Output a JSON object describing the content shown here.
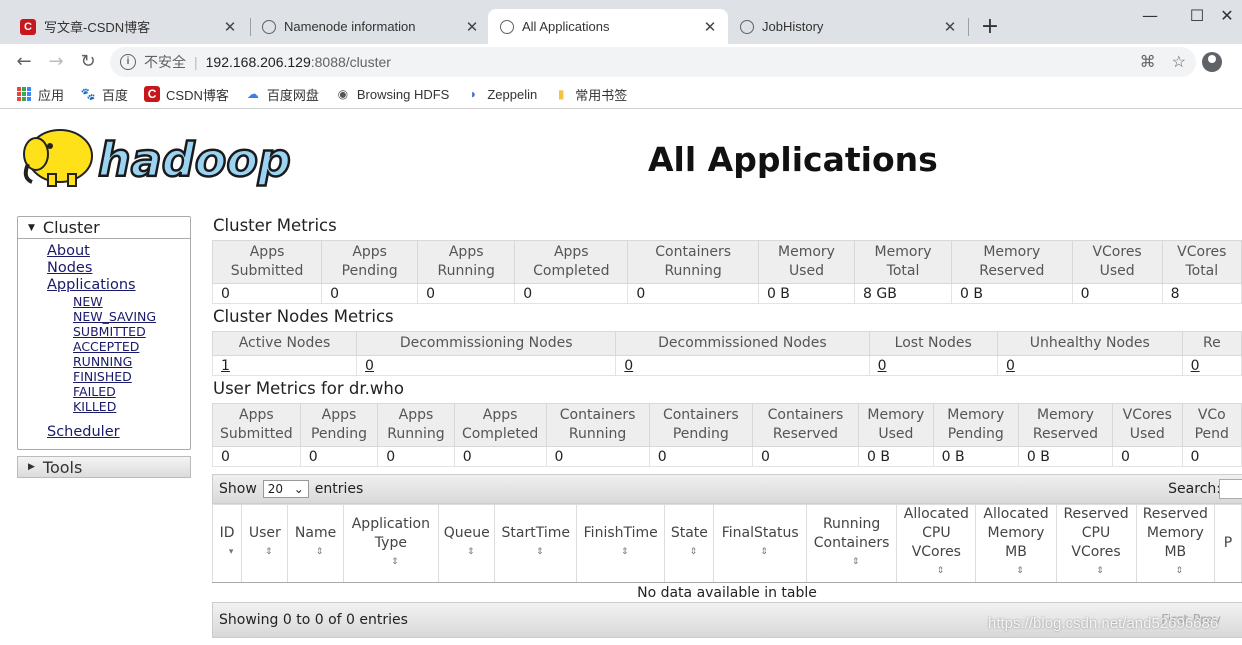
{
  "browser": {
    "tabs": [
      {
        "title": "写文章-CSDN博客",
        "icon": "csdn-icon"
      },
      {
        "title": "Namenode information",
        "icon": "globe-icon"
      },
      {
        "title": "All Applications",
        "icon": "globe-icon"
      },
      {
        "title": "JobHistory",
        "icon": "globe-icon"
      }
    ],
    "insecure_label": "不安全",
    "url_host": "192.168.206.129",
    "url_path": ":8088/cluster",
    "bookmarks": [
      {
        "label": "应用",
        "icon": "apps-grid-icon"
      },
      {
        "label": "百度",
        "icon": "baidu-paw-icon"
      },
      {
        "label": "CSDN博客",
        "icon": "csdn-icon"
      },
      {
        "label": "百度网盘",
        "icon": "cloud-icon"
      },
      {
        "label": "Browsing HDFS",
        "icon": "globe-icon"
      },
      {
        "label": "Zeppelin",
        "icon": "zeppelin-icon"
      },
      {
        "label": "常用书签",
        "icon": "folder-icon"
      }
    ]
  },
  "page": {
    "logo_text": "hadoop",
    "title": "All Applications"
  },
  "sidebar": {
    "cluster_label": "Cluster",
    "links": [
      "About",
      "Nodes",
      "Applications"
    ],
    "app_states": [
      "NEW",
      "NEW_SAVING",
      "SUBMITTED",
      "ACCEPTED",
      "RUNNING",
      "FINISHED",
      "FAILED",
      "KILLED"
    ],
    "scheduler_label": "Scheduler",
    "tools_label": "Tools"
  },
  "cluster_metrics": {
    "title": "Cluster Metrics",
    "headers": [
      [
        "Apps",
        "Submitted"
      ],
      [
        "Apps",
        "Pending"
      ],
      [
        "Apps",
        "Running"
      ],
      [
        "Apps",
        "Completed"
      ],
      [
        "Containers",
        "Running"
      ],
      [
        "Memory",
        "Used"
      ],
      [
        "Memory",
        "Total"
      ],
      [
        "Memory",
        "Reserved"
      ],
      [
        "VCores",
        "Used"
      ],
      [
        "VCores",
        "Total"
      ]
    ],
    "values": [
      "0",
      "0",
      "0",
      "0",
      "0",
      "0 B",
      "8 GB",
      "0 B",
      "0",
      "8"
    ]
  },
  "cluster_nodes_metrics": {
    "title": "Cluster Nodes Metrics",
    "headers": [
      "Active Nodes",
      "Decommissioning Nodes",
      "Decommissioned Nodes",
      "Lost Nodes",
      "Unhealthy Nodes",
      "Re"
    ],
    "values": [
      "1",
      "0",
      "0",
      "0",
      "0",
      "0"
    ]
  },
  "user_metrics": {
    "title": "User Metrics for dr.who",
    "headers": [
      [
        "Apps",
        "Submitted"
      ],
      [
        "Apps",
        "Pending"
      ],
      [
        "Apps",
        "Running"
      ],
      [
        "Apps",
        "Completed"
      ],
      [
        "Containers",
        "Running"
      ],
      [
        "Containers",
        "Pending"
      ],
      [
        "Containers",
        "Reserved"
      ],
      [
        "Memory",
        "Used"
      ],
      [
        "Memory",
        "Pending"
      ],
      [
        "Memory",
        "Reserved"
      ],
      [
        "VCores",
        "Used"
      ],
      [
        "VCo",
        "Pend"
      ]
    ],
    "values": [
      "0",
      "0",
      "0",
      "0",
      "0",
      "0",
      "0",
      "0 B",
      "0 B",
      "0 B",
      "0",
      "0"
    ]
  },
  "apps_table": {
    "show_label": "Show",
    "entries_value": "20",
    "entries_label": "entries",
    "search_label": "Search:",
    "headers": [
      [
        "ID"
      ],
      [
        "User"
      ],
      [
        "Name"
      ],
      [
        "Application",
        "Type"
      ],
      [
        "Queue"
      ],
      [
        "StartTime"
      ],
      [
        "FinishTime"
      ],
      [
        "State"
      ],
      [
        "FinalStatus"
      ],
      [
        "Running",
        "Containers"
      ],
      [
        "Allocated",
        "CPU",
        "VCores"
      ],
      [
        "Allocated",
        "Memory",
        "MB"
      ],
      [
        "Reserved",
        "CPU",
        "VCores"
      ],
      [
        "Reserved",
        "Memory",
        "MB"
      ],
      [
        "P"
      ]
    ],
    "empty_message": "No data available in table",
    "footer_info": "Showing 0 to 0 of 0 entries",
    "pager_label": "First Prev"
  },
  "watermark": "https://blog.csdn.net/and52696686"
}
